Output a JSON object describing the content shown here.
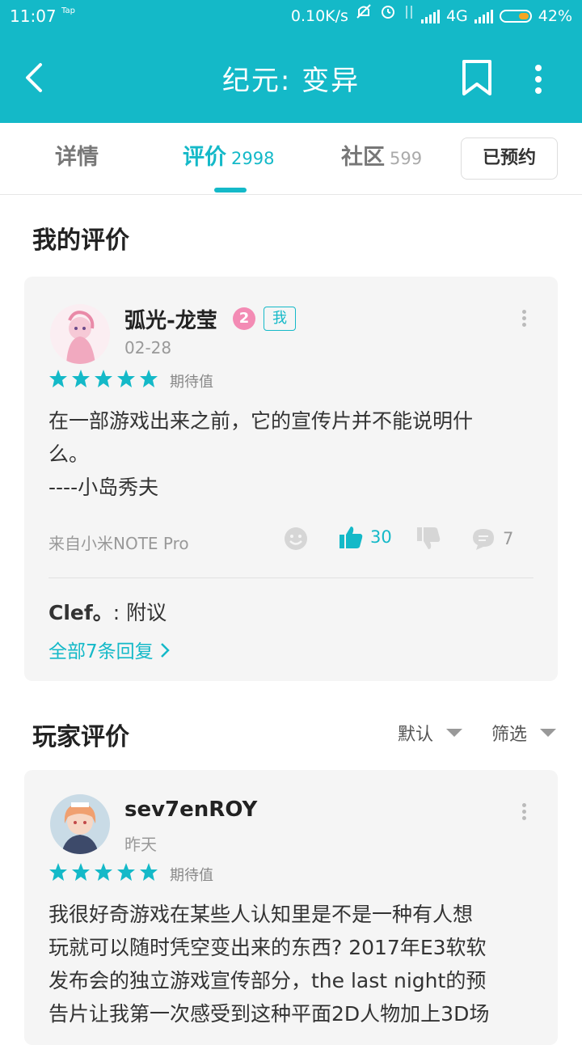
{
  "status_bar": {
    "time": "11:07",
    "tap": "Tap",
    "network_speed": "0.10K/s",
    "network_type": "4G",
    "battery_percent": "42%"
  },
  "header": {
    "title": "纪元: 变异",
    "color": "#14b9c8"
  },
  "tabs": [
    {
      "label": "详情",
      "count": ""
    },
    {
      "label": "评价",
      "count": "2998"
    },
    {
      "label": "社区",
      "count": "599"
    }
  ],
  "reserved_button": "已预约",
  "my_review": {
    "section_title": "我的评价",
    "username": "弧光-龙莹",
    "level": "2",
    "me_badge": "我",
    "date": "02-28",
    "stars": 5,
    "rating_label": "期待值",
    "text": "在一部游戏出来之前，它的宣传片并不能说明什\n么。\n----小岛秀夫",
    "device": "来自小米NOTE Pro",
    "likes": "30",
    "comments": "7",
    "reply": {
      "author": "Clef。",
      "text": ": 附议"
    },
    "all_replies": "全部7条回复"
  },
  "player_reviews": {
    "section_title": "玩家评价",
    "sort_default": "默认",
    "sort_filter": "筛选",
    "first": {
      "username": "sev7enROY",
      "date": "昨天",
      "stars": 5,
      "rating_label": "期待值",
      "text": "我很好奇游戏在某些人认知里是不是一种有人想\n玩就可以随时凭空变出来的东西? 2017年E3软软\n发布会的独立游戏宣传部分，the last night的预\n告片让我第一次感受到这种平面2D人物加上3D场"
    }
  }
}
